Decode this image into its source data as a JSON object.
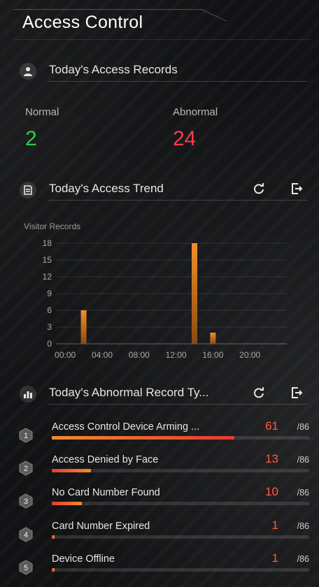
{
  "header": {
    "title": "Access Control"
  },
  "records": {
    "title": "Today's Access Records",
    "icon": "user-icon",
    "normal_label": "Normal",
    "normal_value": "2",
    "abnormal_label": "Abnormal",
    "abnormal_value": "24",
    "colors": {
      "normal": "#2ecc47",
      "abnormal": "#ff3b4a"
    }
  },
  "trend": {
    "title": "Today's Access Trend",
    "icon": "document-icon",
    "refresh_icon": "refresh-icon",
    "export_icon": "export-icon"
  },
  "chart_data": {
    "type": "bar",
    "ylabel": "Visitor Records",
    "x_ticks": [
      "00:00",
      "04:00",
      "08:00",
      "12:00",
      "16:00",
      "20:00"
    ],
    "x": [
      2,
      14,
      16
    ],
    "values": [
      6,
      18,
      2
    ],
    "y_ticks": [
      0,
      3,
      6,
      9,
      12,
      15,
      18
    ],
    "ylim": [
      0,
      18
    ],
    "xlim": [
      -1,
      24
    ],
    "grid": true,
    "bar_color": "#f0902a"
  },
  "abnormal": {
    "title": "Today's Abnormal Record Ty...",
    "icon": "bar-chart-icon",
    "refresh_icon": "refresh-icon",
    "export_icon": "export-icon",
    "items": [
      {
        "rank": "1",
        "label": "Access Control Device Arming ...",
        "count": "61",
        "total": "/86",
        "value": 61,
        "max": 86
      },
      {
        "rank": "2",
        "label": "Access Denied by Face",
        "count": "13",
        "total": "/86",
        "value": 13,
        "max": 86
      },
      {
        "rank": "3",
        "label": "No Card Number Found",
        "count": "10",
        "total": "/86",
        "value": 10,
        "max": 86
      },
      {
        "rank": "4",
        "label": "Card Number Expired",
        "count": "1",
        "total": "/86",
        "value": 1,
        "max": 86
      },
      {
        "rank": "5",
        "label": "Device Offline",
        "count": "1",
        "total": "/86",
        "value": 1,
        "max": 86
      }
    ]
  }
}
